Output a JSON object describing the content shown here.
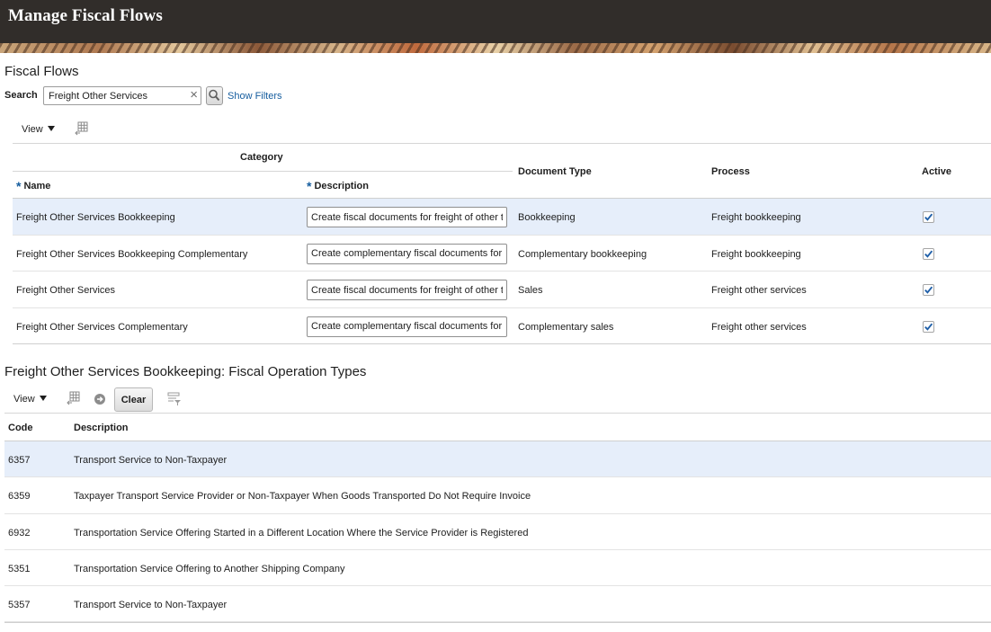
{
  "app": {
    "title": "Manage Fiscal Flows"
  },
  "fiscal_flows": {
    "title": "Fiscal Flows",
    "search": {
      "label": "Search",
      "value": "Freight Other Services",
      "show_filters": "Show Filters"
    },
    "toolbar": {
      "view_label": "View"
    },
    "columns": {
      "category": "Category",
      "name": "Name",
      "description": "Description",
      "document_type": "Document Type",
      "process": "Process",
      "active": "Active",
      "required_marker": "*"
    },
    "rows": [
      {
        "name": "Freight Other Services Bookkeeping",
        "description": "Create fiscal documents for freight of other t",
        "document_type": "Bookkeeping",
        "process": "Freight bookkeeping",
        "active": true,
        "selected": true
      },
      {
        "name": "Freight Other Services Bookkeeping Complementary",
        "description": "Create complementary fiscal documents for",
        "document_type": "Complementary bookkeeping",
        "process": "Freight bookkeeping",
        "active": true,
        "selected": false
      },
      {
        "name": "Freight Other Services",
        "description": "Create fiscal documents for freight of other t",
        "document_type": "Sales",
        "process": "Freight other services",
        "active": true,
        "selected": false
      },
      {
        "name": "Freight Other Services Complementary",
        "description": "Create complementary fiscal documents for",
        "document_type": "Complementary sales",
        "process": "Freight other services",
        "active": true,
        "selected": false
      }
    ]
  },
  "operation_types": {
    "title": "Freight Other Services Bookkeeping: Fiscal Operation Types",
    "toolbar": {
      "view_label": "View",
      "clear_label": "Clear"
    },
    "columns": {
      "code": "Code",
      "description": "Description"
    },
    "rows": [
      {
        "code": "6357",
        "description": "Transport Service to Non-Taxpayer",
        "selected": true
      },
      {
        "code": "6359",
        "description": "Taxpayer Transport Service Provider or Non-Taxpayer When Goods Transported Do Not Require Invoice",
        "selected": false
      },
      {
        "code": "6932",
        "description": "Transportation Service Offering Started in a Different Location Where the Service Provider is Registered",
        "selected": false
      },
      {
        "code": "5351",
        "description": "Transportation Service Offering to Another Shipping Company",
        "selected": false
      },
      {
        "code": "5357",
        "description": "Transport Service to Non-Taxpayer",
        "selected": false
      }
    ]
  },
  "colors": {
    "header_bg": "#312d2a",
    "link": "#145c9e",
    "selected_row": "#e6eefa",
    "check": "#1f5fa8"
  }
}
